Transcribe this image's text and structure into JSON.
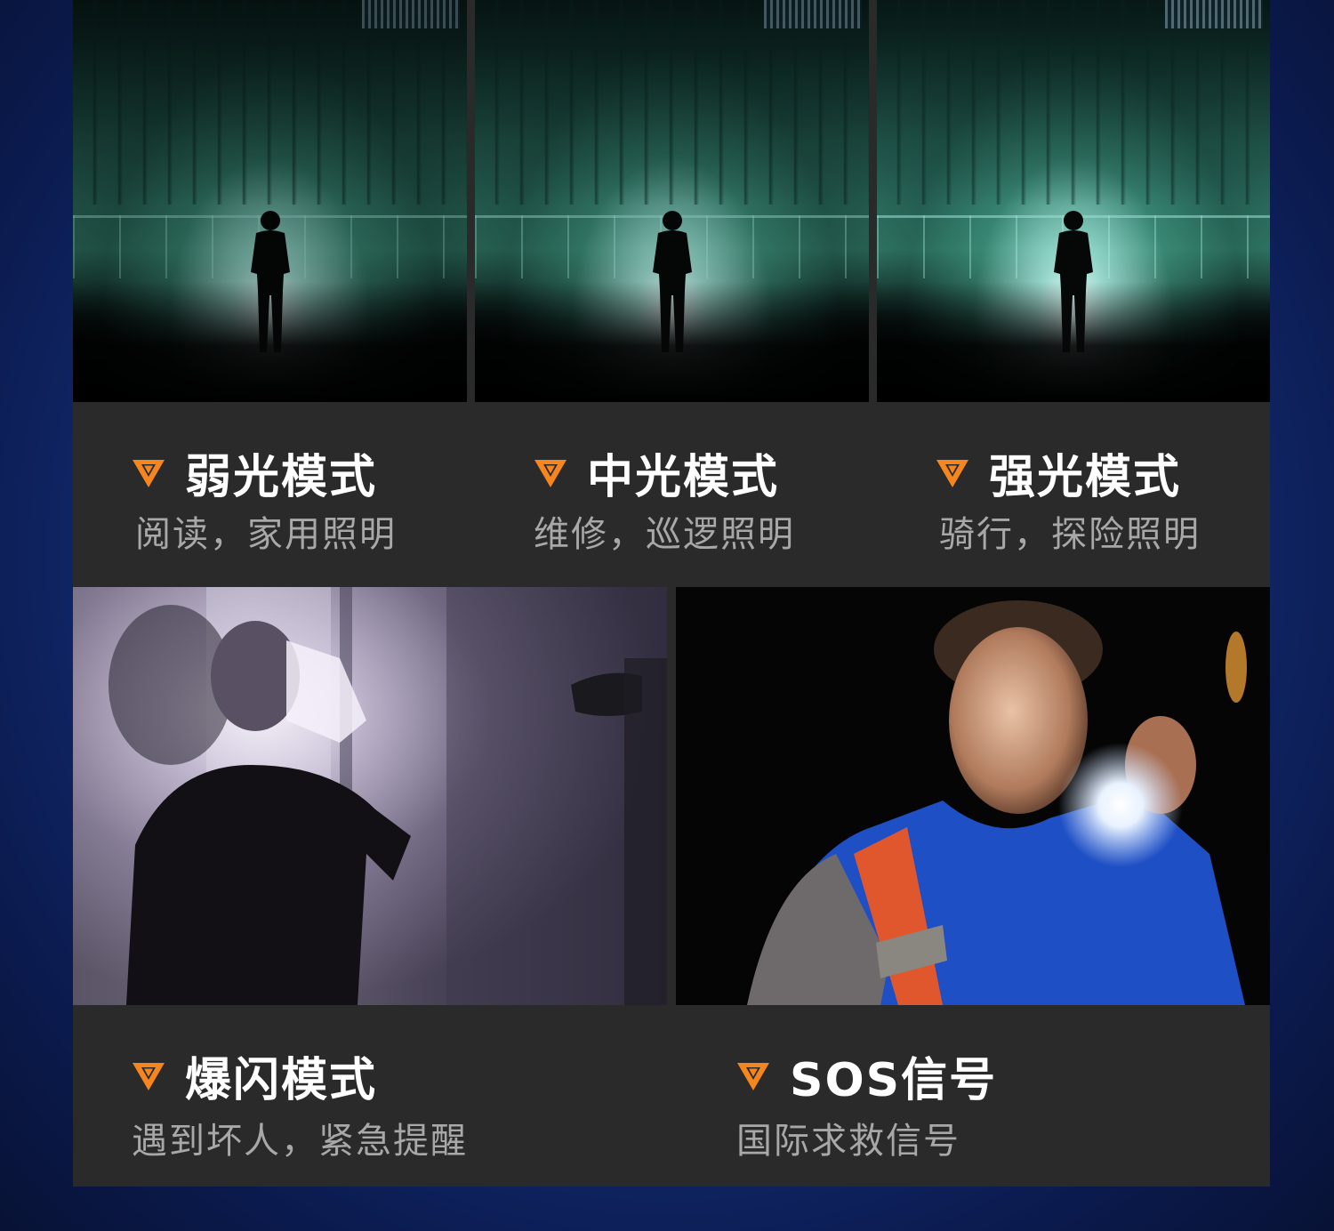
{
  "modes": [
    {
      "title": "弱光模式",
      "desc": "阅读，家用照明"
    },
    {
      "title": "中光模式",
      "desc": "维修，巡逻照明"
    },
    {
      "title": "强光模式",
      "desc": "骑行，探险照明"
    },
    {
      "title": "爆闪模式",
      "desc": "遇到坏人，紧急提醒"
    },
    {
      "title": "SOS信号",
      "desc": "国际求救信号"
    }
  ],
  "colors": {
    "accent": "#f5861f",
    "panel": "#2a2a2b",
    "background": "#1a3b8f",
    "title": "#ffffff",
    "desc": "#a8a8a8"
  },
  "icons": {
    "bullet": "triangle-bullet-icon"
  }
}
